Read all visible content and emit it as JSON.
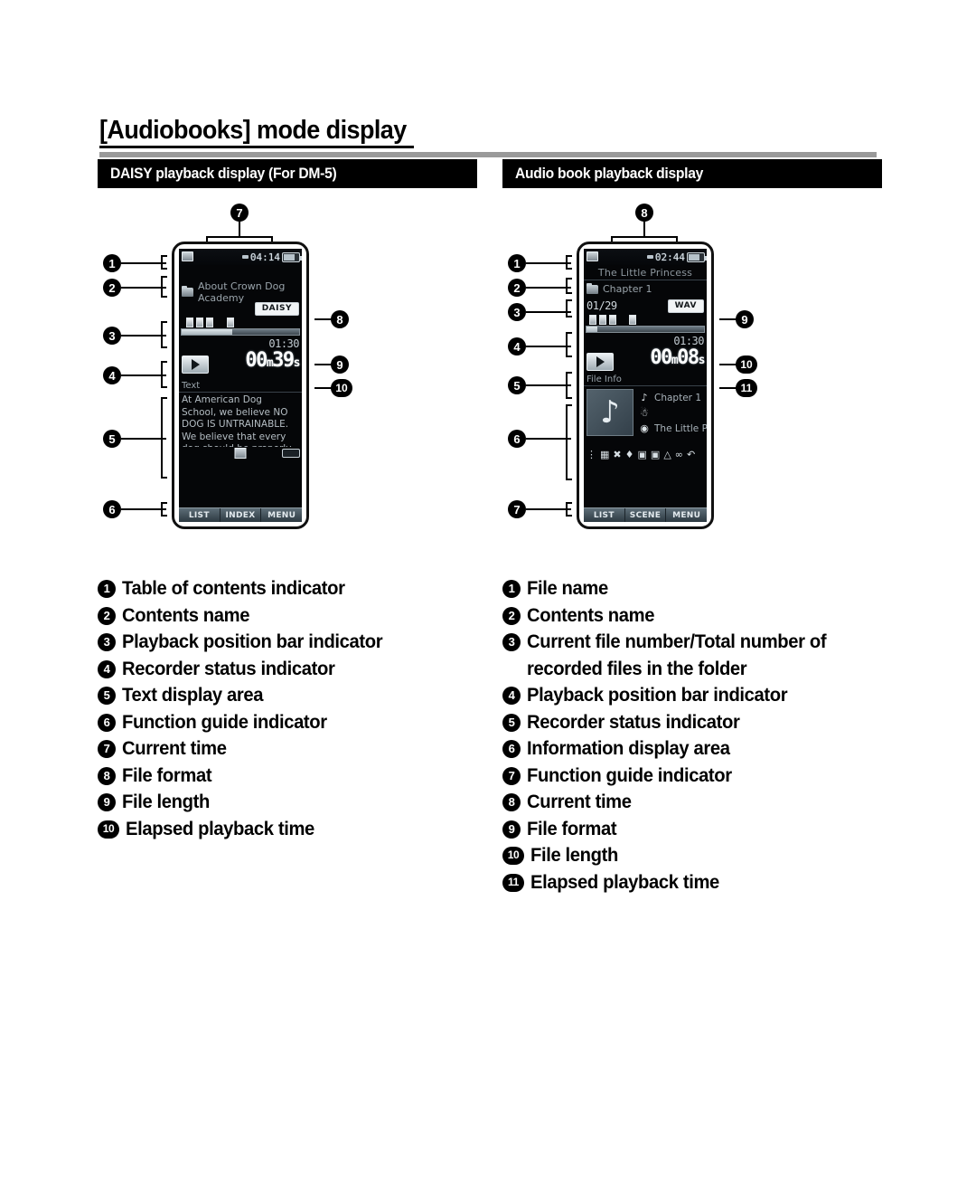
{
  "page": {
    "title": "[Audiobooks] mode display"
  },
  "sections": {
    "left": {
      "header": "DAISY playback display (For DM-5)"
    },
    "right": {
      "header": "Audio book playback display"
    }
  },
  "daisy_display": {
    "status_bar": {
      "toc_icon": "table-of-contents-icon",
      "alarm_icon": "alarm-icon",
      "current_time": "04:14",
      "battery_icon": "battery-icon"
    },
    "contents_name": "About Crown Dog Academy",
    "folder_icon": "folder-icon",
    "file_format": "DAISY",
    "index_marks": [
      "index-mark",
      "index-mark",
      "index-mark",
      "index-mark"
    ],
    "progress_percent": 43,
    "file_length": "01:30",
    "elapsed_time": "00:39",
    "elapsed_minutes": "00",
    "elapsed_seconds": "39",
    "elapsed_sep": "m",
    "elapsed_unit": "s",
    "recorder_status": "play-icon",
    "text_area_label": "Text",
    "text_body": "At American Dog School, we believe NO DOG IS UNTRAINABLE. We believe that every dog should be properly trained. The",
    "bottom_icons": [
      "eq-icon",
      "repeat-icon"
    ],
    "function_guide": [
      "LIST",
      "INDEX",
      "MENU"
    ]
  },
  "audiobook_display": {
    "status_bar": {
      "toc_icon": "table-of-contents-icon",
      "alarm_icon": "alarm-icon",
      "current_time": "02:44",
      "battery_icon": "battery-icon"
    },
    "file_name": "The Little Princess",
    "contents_name": "Chapter 1",
    "folder_icon": "folder-icon",
    "file_number": "01/29",
    "file_format": "WAV",
    "index_marks": [
      "index-mark",
      "index-mark",
      "index-mark",
      "index-mark"
    ],
    "progress_percent": 9,
    "file_length": "01:30",
    "elapsed_time": "00:08",
    "elapsed_minutes": "00",
    "elapsed_seconds": "08",
    "elapsed_sep": "m",
    "elapsed_unit": "s",
    "recorder_status": "play-icon",
    "info_area_label": "File Info",
    "album_art_icon": "music-note-icon",
    "track_title": "Chapter 1",
    "artist": "",
    "album": "The Little Princess",
    "meta_icons": [
      "music-note-icon",
      "artist-icon",
      "album-disc-icon"
    ],
    "status_icons": [
      "eq-icon",
      "lcd-icon",
      "noise-cancel-icon",
      "voice-filter-icon",
      "play-mode-icon",
      "play-mode-icon-2",
      "alarm-icon",
      "shuffle-icon",
      "repeat-icon"
    ],
    "function_guide": [
      "LIST",
      "SCENE",
      "MENU"
    ]
  },
  "callouts": {
    "left_diagram": [
      "1",
      "2",
      "3",
      "4",
      "5",
      "6",
      "7",
      "8",
      "9",
      "10"
    ],
    "right_diagram": [
      "1",
      "2",
      "3",
      "4",
      "5",
      "6",
      "7",
      "8",
      "9",
      "10",
      "11"
    ]
  },
  "legend_left": [
    {
      "num": "1",
      "label": "Table of contents indicator"
    },
    {
      "num": "2",
      "label": "Contents name"
    },
    {
      "num": "3",
      "label": "Playback position bar indicator"
    },
    {
      "num": "4",
      "label": "Recorder status indicator"
    },
    {
      "num": "5",
      "label": "Text display area"
    },
    {
      "num": "6",
      "label": "Function guide indicator"
    },
    {
      "num": "7",
      "label": "Current time"
    },
    {
      "num": "8",
      "label": "File format"
    },
    {
      "num": "9",
      "label": "File length"
    },
    {
      "num": "10",
      "label": "Elapsed playback time"
    }
  ],
  "legend_right": [
    {
      "num": "1",
      "label": "File name"
    },
    {
      "num": "2",
      "label": "Contents name"
    },
    {
      "num": "3",
      "label": "Current file number/Total number of recorded files in the folder"
    },
    {
      "num": "4",
      "label": "Playback position bar indicator"
    },
    {
      "num": "5",
      "label": "Recorder status indicator"
    },
    {
      "num": "6",
      "label": "Information display area"
    },
    {
      "num": "7",
      "label": "Function guide indicator"
    },
    {
      "num": "8",
      "label": "Current time"
    },
    {
      "num": "9",
      "label": "File format"
    },
    {
      "num": "10",
      "label": "File length"
    },
    {
      "num": "11",
      "label": "Elapsed playback time"
    }
  ]
}
